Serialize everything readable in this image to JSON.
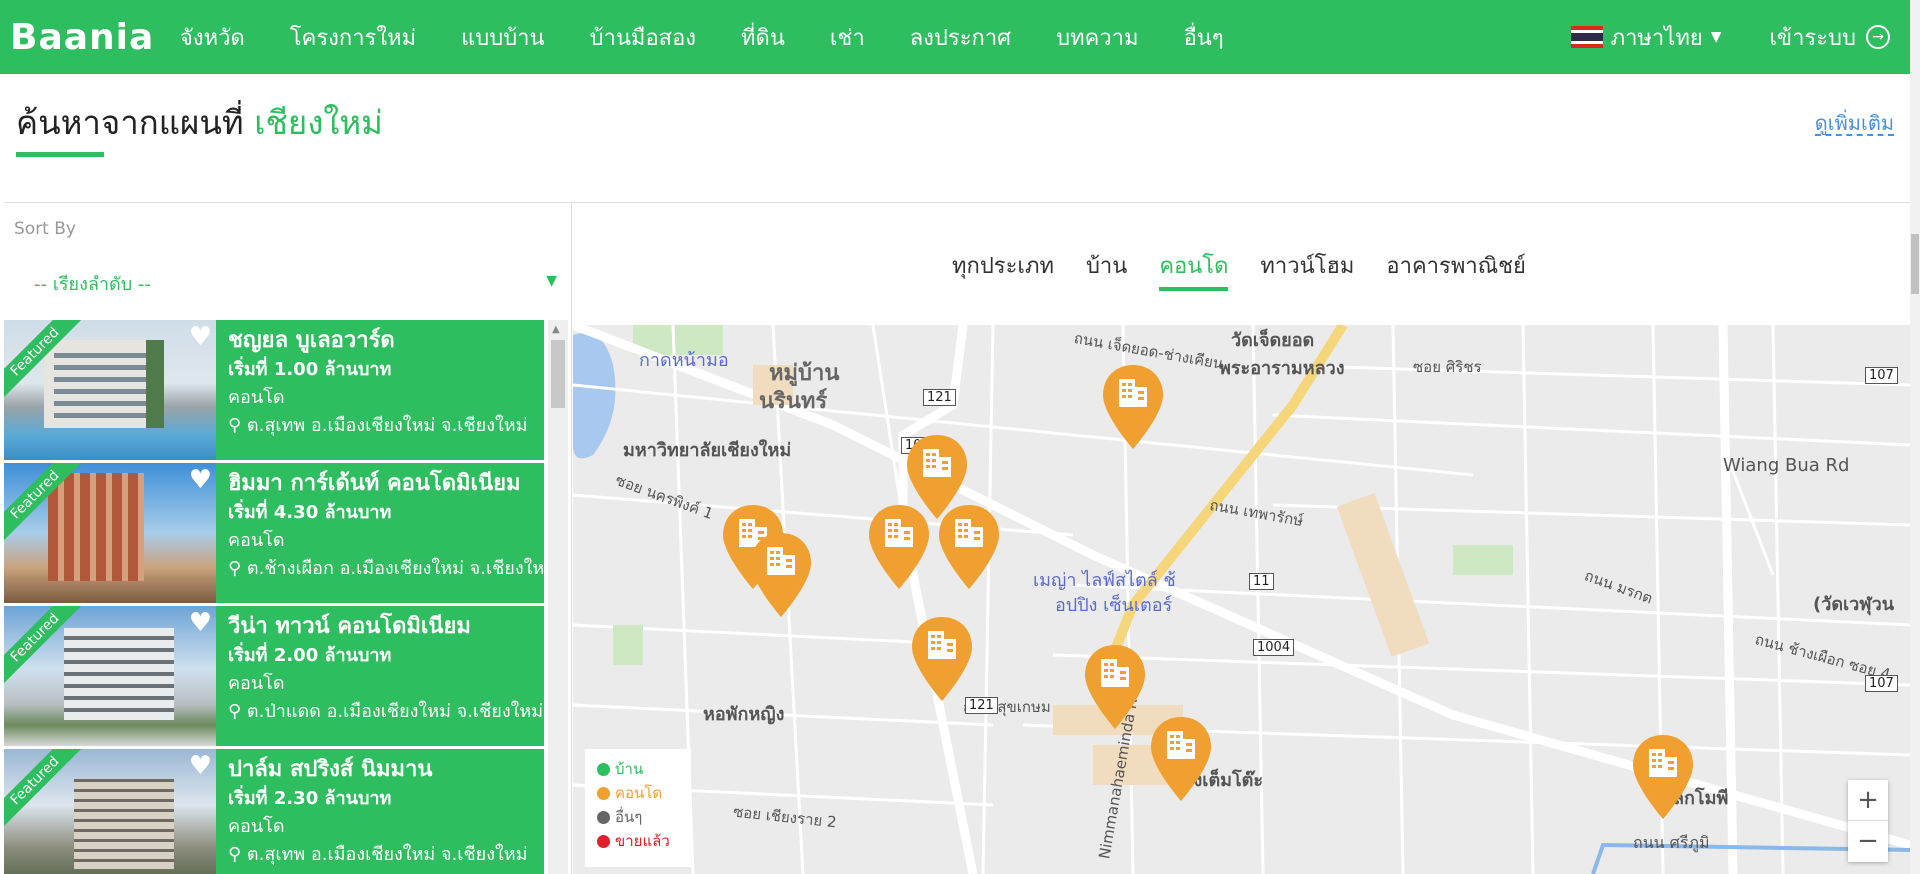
{
  "nav": {
    "logo": "Baania",
    "items": [
      "จังหวัด",
      "โครงการใหม่",
      "แบบบ้าน",
      "บ้านมือสอง",
      "ที่ดิน",
      "เช่า",
      "ลงประกาศ",
      "บทความ",
      "อื่นๆ"
    ],
    "language": "ภาษาไทย",
    "login": "เข้าระบบ"
  },
  "header": {
    "title_prefix": "ค้นหาจากแผนที่",
    "title_city": "เชียงใหม่",
    "see_more": "ดูเพิ่มเติม"
  },
  "sidebar": {
    "sort_label": "Sort By",
    "sort_value": "-- เรียงลำดับ --",
    "cards": [
      {
        "badge": "Featured",
        "name": "ชญยล บูเลอวาร์ด",
        "price": "เริ่มที่ 1.00 ล้านบาท",
        "type": "คอนโด",
        "location": "ต.สุเทพ อ.เมืองเชียงใหม่ จ.เชียงใหม่"
      },
      {
        "badge": "Featured",
        "name": "ฮิมมา การ์เด้นท์ คอนโดมิเนียม",
        "price": "เริ่มที่ 4.30 ล้านบาท",
        "type": "คอนโด",
        "location": "ต.ช้างเผือก อ.เมืองเชียงใหม่ จ.เชียงใหม่"
      },
      {
        "badge": "Featured",
        "name": "วีน่า ทาวน์ คอนโดมิเนียม",
        "price": "เริ่มที่ 2.00 ล้านบาท",
        "type": "คอนโด",
        "location": "ต.ป่าแดด อ.เมืองเชียงใหม่ จ.เชียงใหม่"
      },
      {
        "badge": "Featured",
        "name": "ปาล์ม สปริงส์ นิมมาน",
        "price": "เริ่มที่ 2.30 ล้านบาท",
        "type": "คอนโด",
        "location": "ต.สุเทพ อ.เมืองเชียงใหม่ จ.เชียงใหม่"
      }
    ]
  },
  "tabs": [
    {
      "label": "ทุกประเภท",
      "active": false
    },
    {
      "label": "บ้าน",
      "active": false
    },
    {
      "label": "คอนโด",
      "active": true
    },
    {
      "label": "ทาวน์โฮม",
      "active": false
    },
    {
      "label": "อาคารพาณิชย์",
      "active": false
    }
  ],
  "map": {
    "labels": {
      "l1": "กาดหน้ามอ",
      "l2": "หมู่บ้าน",
      "l3": "นรินทร์",
      "l4": "วัดเจ็ดยอด",
      "l5": "พระอารามหลวง",
      "l6": "มหาวิทยาลัยเชียงใหม่",
      "l7": "เมญ่า ไลฟ์สไตล์ ช้",
      "l8": "อปปิง เซ็นเตอร์",
      "l9": "หอพักหญิง",
      "l10": "ต่องเต็มโต๊ะ",
      "l11": "Wiang Bua Rd",
      "l12": "(วัดเวฬุวน",
      "l13": "Nimmanahaeminda Rd",
      "l14": "ลกโมพี",
      "l15": "ถนน ศรีภูมิ",
      "l16": "ถนน เจ็ดยอด-ช่างเคียน",
      "l17": "ซอย ศิริชร",
      "l18": "ถนน เทพารักษ์",
      "l19": "ถนน มรกต",
      "l20": "ถนน ช้างเผือก ซอย 4",
      "l21": "ซอย เชียงราย 2",
      "l22": "ถนน สุขเกษม",
      "l23": "ซอย นครพิงค์ 1"
    },
    "route_shields": [
      "121",
      "1004",
      "107",
      "11",
      "1004",
      "121",
      "107"
    ],
    "legend": [
      {
        "label": "บ้าน",
        "color": "#2ebd5f"
      },
      {
        "label": "คอนโด",
        "color": "#f0a030"
      },
      {
        "label": "อื่นๆ",
        "color": "#666666"
      },
      {
        "label": "ขายแล้ว",
        "color": "#e0202a"
      }
    ],
    "zoom_in": "+",
    "zoom_out": "−",
    "pin_color": "#f0a030"
  },
  "colors": {
    "brand": "#2ebd5f",
    "link": "#4a90d9"
  }
}
